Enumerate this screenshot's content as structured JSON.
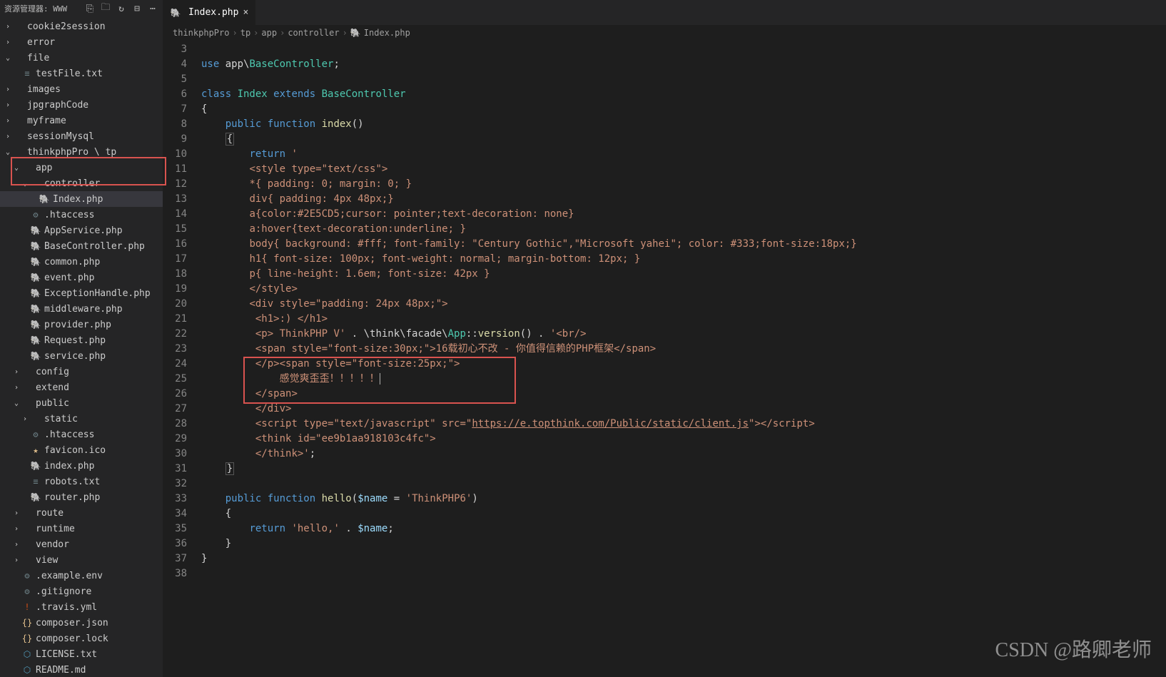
{
  "sidebar": {
    "title": "资源管理器: WWW"
  },
  "tree": [
    {
      "d": 0,
      "t": "f",
      "e": 1,
      "n": "cookie2session"
    },
    {
      "d": 0,
      "t": "f",
      "e": 1,
      "n": "error"
    },
    {
      "d": 0,
      "t": "f",
      "e": 2,
      "n": "file"
    },
    {
      "d": 1,
      "t": "txt",
      "n": "testFile.txt"
    },
    {
      "d": 0,
      "t": "f",
      "e": 1,
      "n": "images"
    },
    {
      "d": 0,
      "t": "f",
      "e": 1,
      "n": "jpgraphCode"
    },
    {
      "d": 0,
      "t": "f",
      "e": 1,
      "n": "myframe"
    },
    {
      "d": 0,
      "t": "f",
      "e": 1,
      "n": "sessionMysql"
    },
    {
      "d": 0,
      "t": "f",
      "e": 2,
      "n": "thinkphpPro \\ tp"
    },
    {
      "d": 1,
      "t": "f",
      "e": 2,
      "n": "app"
    },
    {
      "d": 2,
      "t": "f",
      "e": 2,
      "n": "controller",
      "hl": 1
    },
    {
      "d": 3,
      "t": "php",
      "n": "Index.php",
      "sel": 1,
      "hl": 1
    },
    {
      "d": 2,
      "t": "env",
      "n": ".htaccess"
    },
    {
      "d": 2,
      "t": "php",
      "n": "AppService.php"
    },
    {
      "d": 2,
      "t": "php",
      "n": "BaseController.php"
    },
    {
      "d": 2,
      "t": "php",
      "n": "common.php"
    },
    {
      "d": 2,
      "t": "php",
      "n": "event.php"
    },
    {
      "d": 2,
      "t": "php",
      "n": "ExceptionHandle.php"
    },
    {
      "d": 2,
      "t": "php",
      "n": "middleware.php"
    },
    {
      "d": 2,
      "t": "php",
      "n": "provider.php"
    },
    {
      "d": 2,
      "t": "php",
      "n": "Request.php"
    },
    {
      "d": 2,
      "t": "php",
      "n": "service.php"
    },
    {
      "d": 1,
      "t": "f",
      "e": 1,
      "n": "config"
    },
    {
      "d": 1,
      "t": "f",
      "e": 1,
      "n": "extend"
    },
    {
      "d": 1,
      "t": "f",
      "e": 2,
      "n": "public"
    },
    {
      "d": 2,
      "t": "f",
      "e": 1,
      "n": "static"
    },
    {
      "d": 2,
      "t": "env",
      "n": ".htaccess"
    },
    {
      "d": 2,
      "t": "star",
      "n": "favicon.ico"
    },
    {
      "d": 2,
      "t": "php",
      "n": "index.php"
    },
    {
      "d": 2,
      "t": "txt",
      "n": "robots.txt"
    },
    {
      "d": 2,
      "t": "php",
      "n": "router.php"
    },
    {
      "d": 1,
      "t": "f",
      "e": 1,
      "n": "route"
    },
    {
      "d": 1,
      "t": "f",
      "e": 1,
      "n": "runtime"
    },
    {
      "d": 1,
      "t": "f",
      "e": 1,
      "n": "vendor"
    },
    {
      "d": 1,
      "t": "f",
      "e": 1,
      "n": "view"
    },
    {
      "d": 1,
      "t": "env",
      "n": ".example.env"
    },
    {
      "d": 1,
      "t": "env",
      "n": ".gitignore"
    },
    {
      "d": 1,
      "t": "yml",
      "n": ".travis.yml"
    },
    {
      "d": 1,
      "t": "json",
      "n": "composer.json"
    },
    {
      "d": 1,
      "t": "json",
      "n": "composer.lock"
    },
    {
      "d": 1,
      "t": "cyan",
      "n": "LICENSE.txt"
    },
    {
      "d": 1,
      "t": "cyan",
      "n": "README.md"
    }
  ],
  "tab": {
    "name": "Index.php"
  },
  "crumbs": [
    "thinkphpPro",
    "tp",
    "app",
    "controller",
    "Index.php"
  ],
  "lines": [
    3,
    4,
    5,
    6,
    7,
    8,
    9,
    10,
    11,
    12,
    13,
    14,
    15,
    16,
    17,
    18,
    19,
    20,
    21,
    22,
    23,
    24,
    25,
    26,
    27,
    28,
    29,
    30,
    31,
    32,
    33,
    34,
    35,
    36,
    37,
    38
  ],
  "watermark": "CSDN @路卿老师",
  "code": {
    "l4_use": "use",
    "l4_ns": " app\\",
    "l4_cls": "BaseController",
    "l4_end": ";",
    "l6_class": "class ",
    "l6_name": "Index",
    "l6_ext": " extends ",
    "l6_base": "BaseController",
    "l7": "{",
    "l8_pub": "public ",
    "l8_fn": "function ",
    "l8_name": "index",
    "l8_par": "()",
    "l9": "{",
    "l10_ret": "return ",
    "l10_q": "'",
    "l11": "<style type=\"text/css\">",
    "l12": "*{ padding: 0; margin: 0; }",
    "l13": "div{ padding: 4px 48px;}",
    "l14": "a{color:#2E5CD5;cursor: pointer;text-decoration: none}",
    "l15": "a:hover{text-decoration:underline; }",
    "l16": "body{ background: #fff; font-family: \"Century Gothic\",\"Microsoft yahei\"; color: #333;font-size:18px;}",
    "l17": "h1{ font-size: 100px; font-weight: normal; margin-bottom: 12px; }",
    "l18": "p{ line-height: 1.6em; font-size: 42px }",
    "l19": "</style>",
    "l20": "<div style=\"padding: 24px 48px;\">",
    "l21": " <h1>:) </h1>",
    "l22a": " <p> ThinkPHP V'",
    "l22b": " . \\think\\facade\\",
    "l22c": "App",
    "l22d": "::",
    "l22e": "version",
    "l22f": "()",
    "l22g": " . ",
    "l22h": "'<br/>",
    "l23": " <span style=\"font-size:30px;\">16载初心不改 - 你值得信赖的PHP框架</span>",
    "l24": " </p><span style=\"font-size:25px;\">",
    "l25": "     感觉爽歪歪！！！！！",
    "l26": " </span>",
    "l27": " </div>",
    "l28a": " <script type=\"text/javascript\" src=\"",
    "l28b": "https://e.topthink.com/Public/static/client.js",
    "l28c": "\"></script>",
    "l29": " <think id=\"ee9b1aa918103c4fc\">",
    "l30a": " </think>'",
    "l30b": ";",
    "l31": "}",
    "l33_pub": "public ",
    "l33_fn": "function ",
    "l33_name": "hello",
    "l33_par": "(",
    "l33_var": "$name",
    "l33_eq": " = ",
    "l33_def": "'ThinkPHP6'",
    "l33_cp": ")",
    "l34": "{",
    "l35_ret": "return ",
    "l35_str": "'hello,'",
    "l35_dot": " . ",
    "l35_var": "$name",
    "l35_end": ";",
    "l36": "}",
    "l37": "}"
  }
}
